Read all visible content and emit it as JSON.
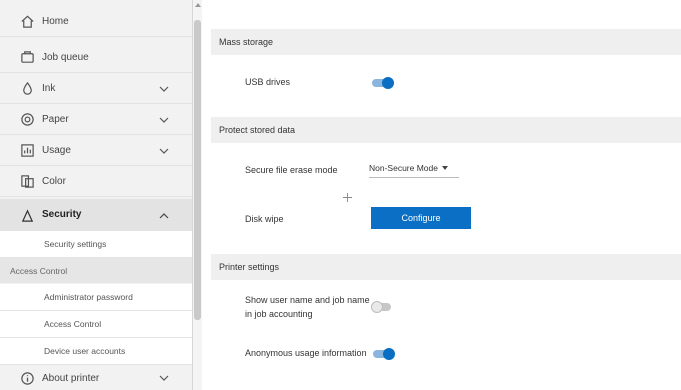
{
  "sidebar": {
    "items": [
      {
        "label": "Home",
        "icon": "home-icon",
        "chevron": false
      },
      {
        "label": "Job queue",
        "icon": "job-queue-icon",
        "chevron": false
      },
      {
        "label": "Ink",
        "icon": "ink-drop-icon",
        "chevron": true
      },
      {
        "label": "Paper",
        "icon": "paper-roll-icon",
        "chevron": true
      },
      {
        "label": "Usage",
        "icon": "usage-icon",
        "chevron": true
      },
      {
        "label": "Color",
        "icon": "color-icon",
        "chevron": false
      },
      {
        "label": "Security",
        "icon": "lock-icon",
        "chevron": true,
        "expanded": true
      },
      {
        "label": "About printer",
        "icon": "info-icon",
        "chevron": true
      }
    ],
    "security_sub": {
      "security_settings": "Security settings"
    },
    "access_control_group": "Access Control",
    "access_items": [
      "Administrator password",
      "Access Control",
      "Device user accounts"
    ]
  },
  "main": {
    "mass_storage": {
      "header": "Mass storage",
      "usb_label": "USB drives",
      "usb_enabled": true
    },
    "protect_stored_data": {
      "header": "Protect stored data",
      "erase_mode_label": "Secure file erase mode",
      "erase_mode_value": "Non-Secure Mode",
      "disk_wipe_label": "Disk wipe",
      "configure_label": "Configure"
    },
    "printer_settings": {
      "header": "Printer settings",
      "show_user_label_line1": "Show user name and job name",
      "show_user_label_line2": "in job accounting",
      "show_user_enabled": false,
      "anon_usage_label": "Anonymous usage information",
      "anon_usage_enabled": true
    }
  },
  "colors": {
    "accent": "#0b6fc5",
    "toggle_on_track": "#89b5df",
    "sidebar_bg": "#f2f2f2"
  }
}
